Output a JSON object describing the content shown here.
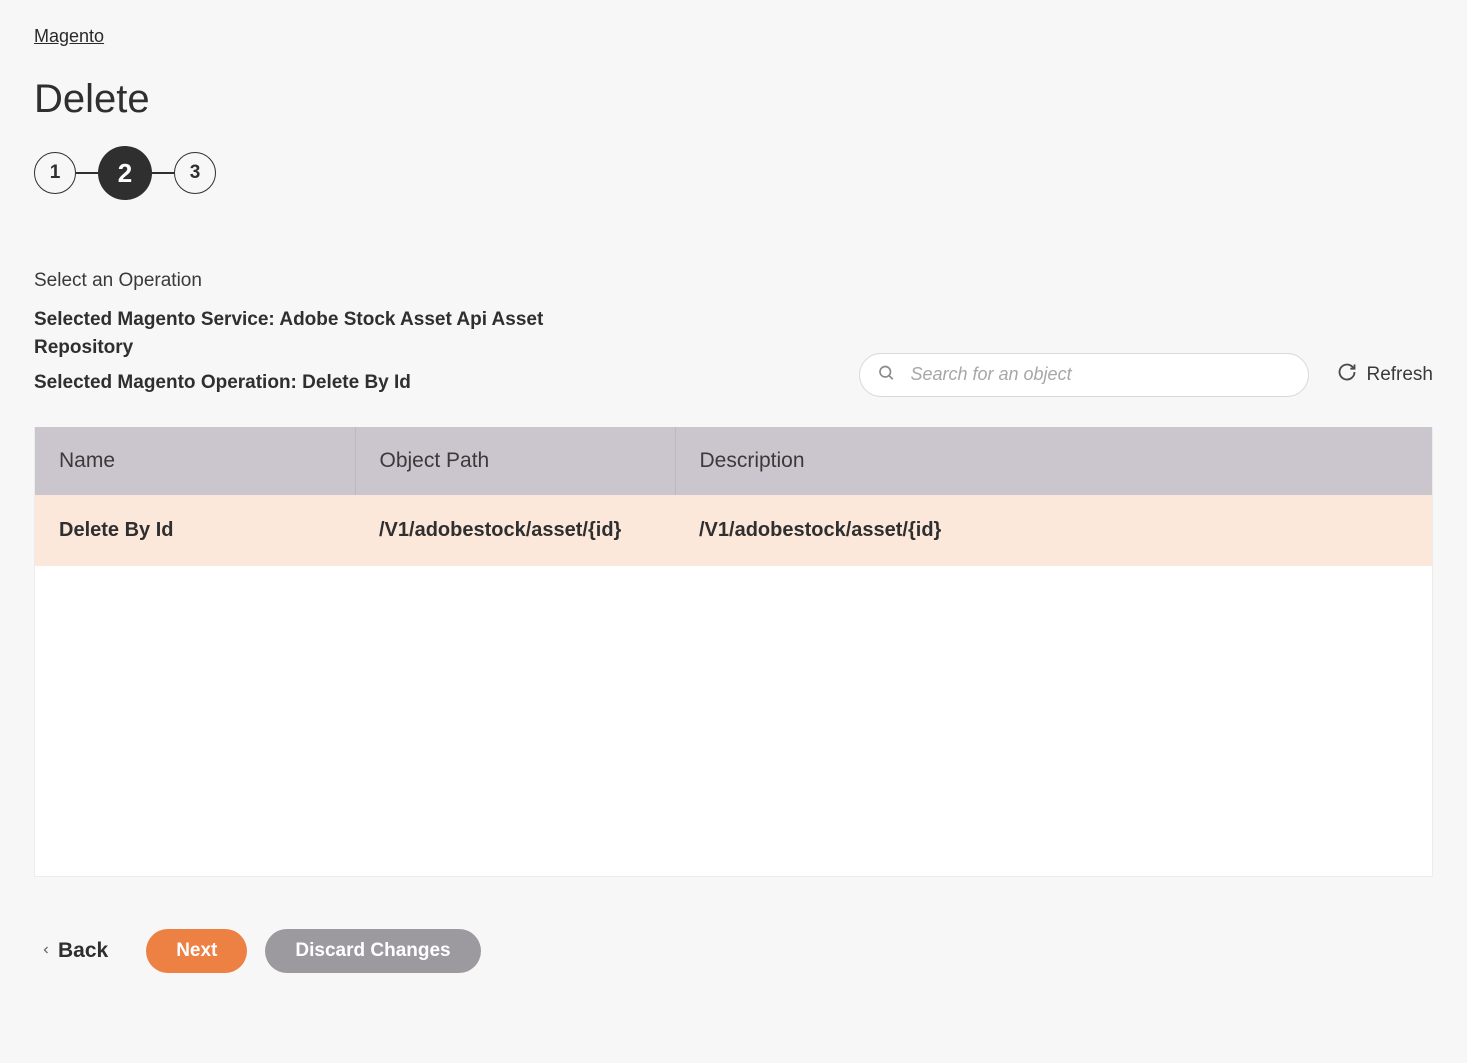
{
  "breadcrumb": "Magento",
  "page_title": "Delete",
  "stepper": {
    "steps": [
      "1",
      "2",
      "3"
    ],
    "active_index": 1
  },
  "section_label": "Select an Operation",
  "selected_service_label": "Selected Magento Service: ",
  "selected_service_value": "Adobe Stock Asset Api Asset Repository",
  "selected_operation_label": "Selected Magento Operation: ",
  "selected_operation_value": "Delete By Id",
  "search": {
    "placeholder": "Search for an object"
  },
  "refresh_label": "Refresh",
  "table": {
    "headers": {
      "name": "Name",
      "object_path": "Object Path",
      "description": "Description"
    },
    "rows": [
      {
        "name": "Delete By Id",
        "object_path": "/V1/adobestock/asset/{id}",
        "description": "/V1/adobestock/asset/{id}",
        "selected": true
      }
    ]
  },
  "footer": {
    "back": "Back",
    "next": "Next",
    "discard": "Discard Changes"
  }
}
